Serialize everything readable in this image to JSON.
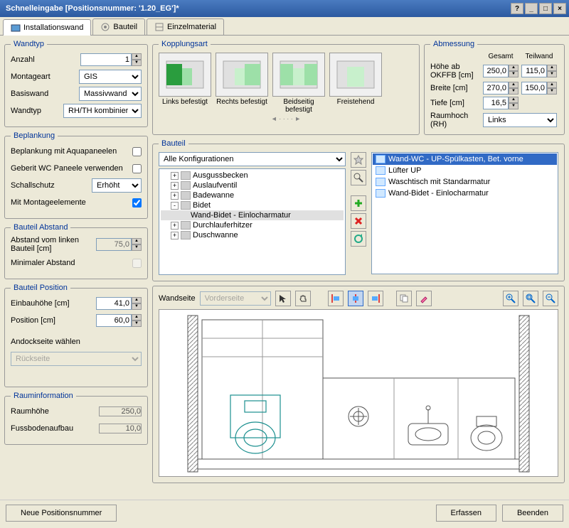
{
  "window": {
    "title": "Schnelleingabe [Positionsnummer: '1.20_EG']*"
  },
  "tabs": [
    {
      "label": "Installationswand",
      "icon": "wall-icon",
      "active": true
    },
    {
      "label": "Bauteil",
      "icon": "component-icon",
      "active": false
    },
    {
      "label": "Einzelmaterial",
      "icon": "material-icon",
      "active": false
    }
  ],
  "wandtyp": {
    "legend": "Wandtyp",
    "anzahl_label": "Anzahl",
    "anzahl_value": "1",
    "montageart_label": "Montageart",
    "montageart_value": "GIS",
    "basiswand_label": "Basiswand",
    "basiswand_value": "Massivwand",
    "wandtyp_label": "Wandtyp",
    "wandtyp_value": "RH/TH kombiniert"
  },
  "kopplungsart": {
    "legend": "Kopplungsart",
    "items": [
      {
        "label": "Links befestigt",
        "selected": false
      },
      {
        "label": "Rechts befestigt",
        "selected": false
      },
      {
        "label": "Beidseitig befestigt",
        "selected": false
      },
      {
        "label": "Freistehend",
        "selected": false
      }
    ]
  },
  "abmessung": {
    "legend": "Abmessung",
    "gesamt_hdr": "Gesamt",
    "teilwand_hdr": "Teilwand",
    "hoehe_label": "Höhe ab OKFFB [cm]",
    "hoehe_gesamt": "250,0",
    "hoehe_teil": "115,0",
    "breite_label": "Breite [cm]",
    "breite_gesamt": "270,0",
    "breite_teil": "150,0",
    "tiefe_label": "Tiefe [cm]",
    "tiefe_value": "16,5",
    "raumhoch_label": "Raumhoch (RH)",
    "raumhoch_value": "Links"
  },
  "beplankung": {
    "legend": "Beplankung",
    "aqua_label": "Beplankung mit Aquapaneelen",
    "aqua_checked": false,
    "geberit_label": "Geberit WC Paneele verwenden",
    "geberit_checked": false,
    "schall_label": "Schallschutz",
    "schall_value": "Erhöht",
    "montage_label": "Mit Montageelemente",
    "montage_checked": true
  },
  "bauteil_abstand": {
    "legend": "Bauteil Abstand",
    "abstand_label": "Abstand vom linken Bauteil [cm]",
    "abstand_value": "75,0",
    "min_label": "Minimaler Abstand",
    "min_checked": false
  },
  "bauteil_position": {
    "legend": "Bauteil Position",
    "einbau_label": "Einbauhöhe [cm]",
    "einbau_value": "41,0",
    "position_label": "Position [cm]",
    "position_value": "60,0",
    "andock_label": "Andockseite wählen",
    "andock_value": "Rückseite"
  },
  "rauminfo": {
    "legend": "Rauminformation",
    "raumhoehe_label": "Raumhöhe",
    "raumhoehe_value": "250,0",
    "fussboden_label": "Fussbodenaufbau",
    "fussboden_value": "10,0"
  },
  "bauteil": {
    "legend": "Bauteil",
    "config_value": "Alle Konfigurationen",
    "tree": [
      {
        "label": "Ausgussbecken",
        "level": 1,
        "exp": "+"
      },
      {
        "label": "Auslaufventil",
        "level": 1,
        "exp": "+"
      },
      {
        "label": "Badewanne",
        "level": 1,
        "exp": "+"
      },
      {
        "label": "Bidet",
        "level": 1,
        "exp": "-"
      },
      {
        "label": "Wand-Bidet - Einlocharmatur",
        "level": 2,
        "exp": "",
        "sel": true
      },
      {
        "label": "Durchlauferhitzer",
        "level": 1,
        "exp": "+"
      },
      {
        "label": "Duschwanne",
        "level": 1,
        "exp": "+"
      }
    ],
    "list": [
      {
        "label": "Wand-WC - UP-Spülkasten, Bet. vorne",
        "sel": true
      },
      {
        "label": "Lüfter UP",
        "sel": false
      },
      {
        "label": "Waschtisch mit Standarmatur",
        "sel": false
      },
      {
        "label": "Wand-Bidet - Einlocharmatur",
        "sel": false
      }
    ],
    "toolbtns": [
      "favorite-icon",
      "find-icon",
      "add-icon",
      "delete-icon",
      "copy-icon"
    ]
  },
  "canvas": {
    "wandseite_label": "Wandseite",
    "wandseite_value": "Vorderseite"
  },
  "footer": {
    "neue_label": "Neue Positionsnummer",
    "erfassen_label": "Erfassen",
    "beenden_label": "Beenden"
  }
}
